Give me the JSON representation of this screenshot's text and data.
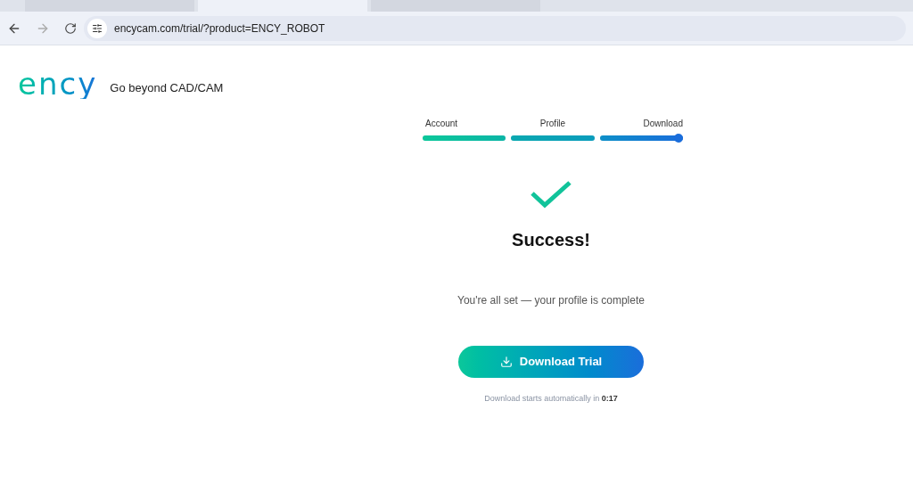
{
  "browser": {
    "url": "encycam.com/trial/?product=ENCY_ROBOT",
    "tabs": [
      {
        "selected": false
      },
      {
        "selected": true
      },
      {
        "selected": false
      }
    ]
  },
  "header": {
    "logo": "ency",
    "tagline": "Go beyond CAD/CAM"
  },
  "steps": [
    {
      "label": "Account",
      "level": 1,
      "selected": false
    },
    {
      "label": "Profile",
      "level": 1,
      "selected": false
    },
    {
      "label": "Download",
      "level": 1,
      "selected": true
    }
  ],
  "result": {
    "title": "Success!",
    "message": "You're all set — your profile is complete",
    "button": "Download Trial",
    "countdown": "Download starts automatically in **0:17**"
  }
}
